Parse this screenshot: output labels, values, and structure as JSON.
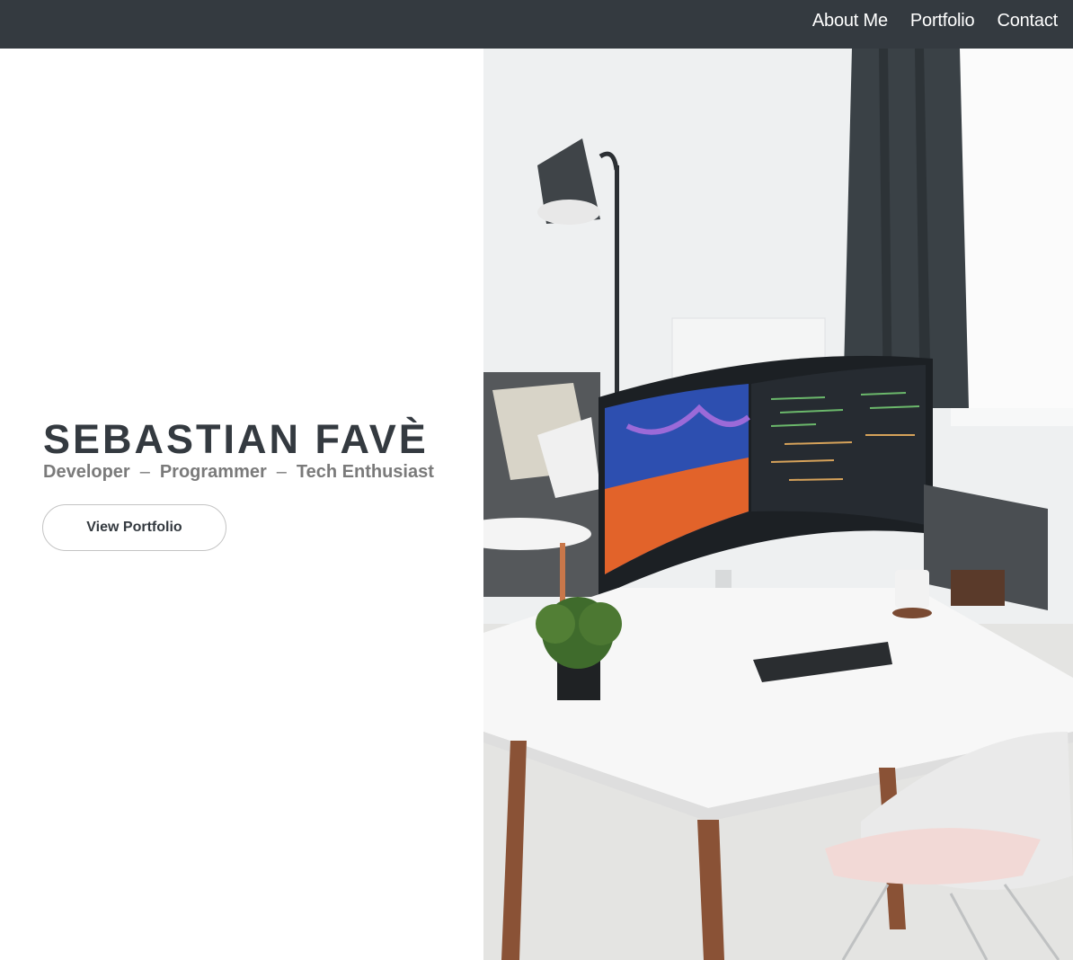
{
  "nav": {
    "items": [
      {
        "label": "About Me"
      },
      {
        "label": "Portfolio"
      },
      {
        "label": "Contact"
      }
    ]
  },
  "hero": {
    "name": "SEBASTIAN FAVÈ",
    "tagline": {
      "parts": [
        "Developer",
        "Programmer",
        "Tech Enthusiast"
      ],
      "separator": "–"
    },
    "button_label": "View Portfolio"
  },
  "image": {
    "description_icon": "desk-setup-photo"
  },
  "colors": {
    "navbar": "#343a40",
    "name_text": "#343a40",
    "tagline_text": "#7a7a7a",
    "button_border": "#c4c4c4"
  }
}
